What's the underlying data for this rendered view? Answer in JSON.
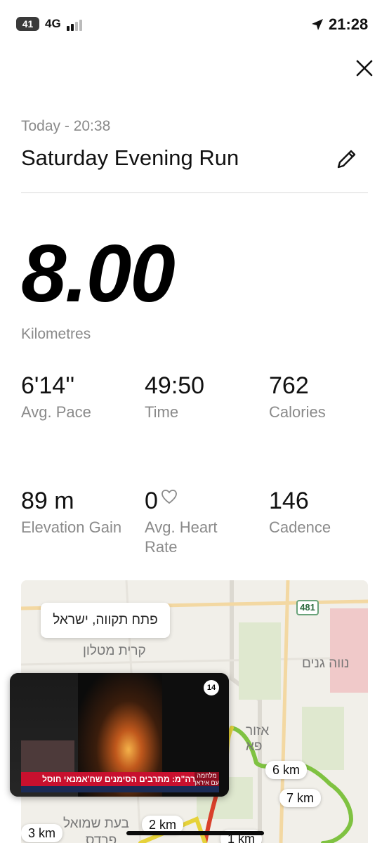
{
  "status_bar": {
    "battery": "41",
    "network": "4G",
    "time": "21:28"
  },
  "activity": {
    "date_time": "Today - 20:38",
    "title": "Saturday Evening Run",
    "distance": "8.00",
    "distance_unit": "Kilometres"
  },
  "stats": [
    {
      "value": "6'14''",
      "label": "Avg. Pace"
    },
    {
      "value": "49:50",
      "label": "Time"
    },
    {
      "value": "762",
      "label": "Calories"
    },
    {
      "value": "89 m",
      "label": "Elevation Gain"
    },
    {
      "value": "0",
      "label": "Avg. Heart Rate"
    },
    {
      "value": "146",
      "label": "Cadence"
    }
  ],
  "map": {
    "place": "פתח תקווה, ישראל",
    "labels": [
      "קרית מטלון",
      "נווה גנים",
      "אזור",
      "פא",
      "בעת שמואל",
      "פרדס"
    ],
    "route_number": "481",
    "km_markers": [
      "6 km",
      "7 km",
      "3 km",
      "2 km",
      "1 km"
    ]
  },
  "video": {
    "channel": "14",
    "headline": "רה\"מ: מתרבים הסימנים שח'אמנאי חוסל",
    "tag": "מלחמה עם איראן"
  },
  "colors": {
    "route_green": "#7fc241",
    "route_yellow": "#e6d23a",
    "route_red": "#d9402b",
    "map_bg": "#f1efe9"
  }
}
